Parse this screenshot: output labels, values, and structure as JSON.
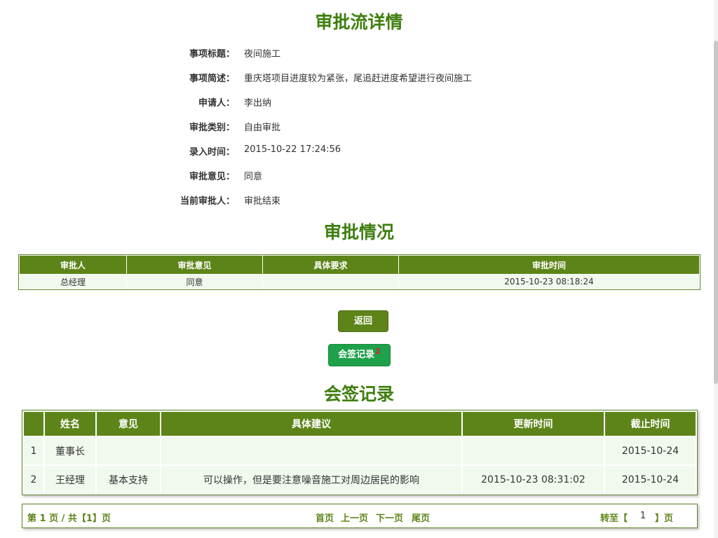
{
  "title": "审批流详情",
  "fields": [
    {
      "label": "事项标题：",
      "value": "夜间施工"
    },
    {
      "label": "事项简述：",
      "value": "重庆塔项目进度较为紧张，尾追赶进度希望进行夜间施工"
    },
    {
      "label": "申请人：",
      "value": "李出纳"
    },
    {
      "label": "审批类别：",
      "value": "自由审批"
    },
    {
      "label": "录入时间：",
      "value": "2015-10-22 17:24:56"
    },
    {
      "label": "审批意见：",
      "value": "同意"
    },
    {
      "label": "当前审批人：",
      "value": "审批结束"
    }
  ],
  "approval": {
    "title": "审批情况",
    "headers": [
      "审批人",
      "审批意见",
      "具体要求",
      "审批时间"
    ],
    "rows": [
      [
        "总经理",
        "同意",
        "",
        "2015-10-23 08:18:24"
      ]
    ]
  },
  "buttons": {
    "back": "返回",
    "sign_record": "会签记录",
    "sign_count": "2"
  },
  "countersign": {
    "title": "会签记录",
    "headers": [
      "",
      "姓名",
      "意见",
      "具体建议",
      "更新时间",
      "截止时间"
    ],
    "rows": [
      [
        "1",
        "董事长",
        "",
        "",
        "",
        "2015-10-24"
      ],
      [
        "2",
        "王经理",
        "基本支持",
        "可以操作，但是要注意噪音施工对周边居民的影响",
        "2015-10-23 08:31:02",
        "2015-10-24"
      ]
    ]
  },
  "pager": {
    "summary": "第 1 页 / 共【1】页",
    "first": "首页",
    "prev": "上一页",
    "next": "下一页",
    "last": "尾页",
    "goto_prefix": "转至【",
    "goto_value": "1",
    "goto_suffix": "】页"
  },
  "colors": {
    "title_green": "#3f7f0f",
    "header_green": "#5d8418",
    "row_bg": "#f1f8ee",
    "sign_button": "#1fa04a",
    "badge_red": "#e0202a"
  }
}
